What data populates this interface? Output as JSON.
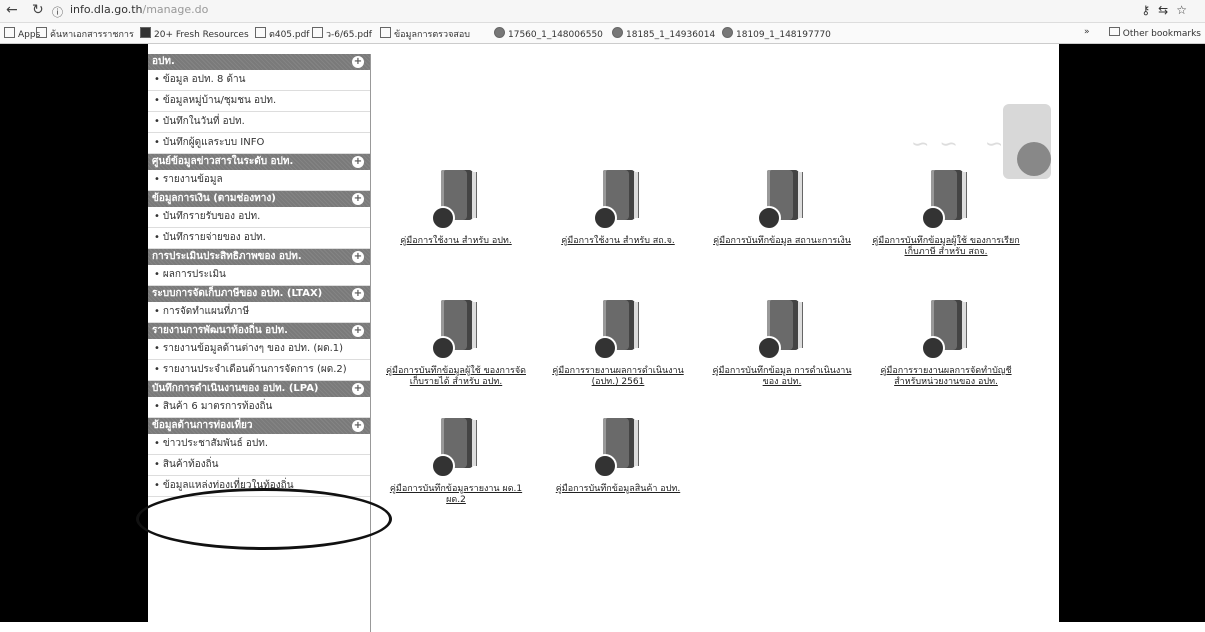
{
  "browser": {
    "url_host": "info.dla.go.th",
    "url_path": "/manage.do",
    "bookmarks": [
      "Apps",
      "ค้นหาเอกสารราชการ",
      "20+ Fresh Resources",
      "ต405.pdf",
      "ว-6/65.pdf",
      "ข้อมูลการตรวจสอบ",
      "17560_1_148006550",
      "18185_1_14936014",
      "18109_1_148197770"
    ],
    "other_bookmarks": "Other bookmarks"
  },
  "sidebar": {
    "sections": [
      {
        "title": "อปท.",
        "items": [
          "ข้อมูล อปท. 8 ด้าน",
          "ข้อมูลหมู่บ้าน/ชุมชน อปท.",
          "บันทึกในวันที่ อปท.",
          "บันทึกผู้ดูแลระบบ INFO"
        ]
      },
      {
        "title": "ศูนย์ข้อมูลข่าวสารในระดับ อปท.",
        "items": [
          "รายงานข้อมูล"
        ]
      },
      {
        "title": "ข้อมูลการเงิน (ตามช่องทาง)",
        "items": [
          "บันทึกรายรับของ อปท.",
          "บันทึกรายจ่ายของ อปท."
        ]
      },
      {
        "title": "การประเมินประสิทธิภาพของ อปท.",
        "items": [
          "ผลการประเมิน"
        ]
      },
      {
        "title": "ระบบการจัดเก็บภาษีของ อปท. (LTAX)",
        "items": [
          "การจัดทำแผนที่ภาษี"
        ]
      },
      {
        "title": "รายงานการพัฒนาท้องถิ่น อปท.",
        "items": [
          "รายงานข้อมูลด้านต่างๆ ของ อปท. (ผด.1)",
          "รายงานประจำเดือนด้านการจัดการ (ผด.2)"
        ]
      },
      {
        "title": "บันทึกการดำเนินงานของ อปท. (LPA)",
        "items": [
          "สินค้า 6 มาตรการท้องถิ่น"
        ]
      },
      {
        "title": "ข้อมูลด้านการท่องเที่ยว",
        "items": [
          "ข่าวประชาสัมพันธ์ อปท.",
          "สินค้าท้องถิ่น",
          "ข้อมูลแหล่งท่องเที่ยวในท้องถิ่น"
        ]
      }
    ]
  },
  "main": {
    "documents": [
      "คู่มือการใช้งาน สำหรับ อปท.",
      "คู่มือการใช้งาน สำหรับ สถ.จ.",
      "คู่มือการบันทึกข้อมูล สถานะการเงิน",
      "คู่มือการบันทึกข้อมูลผู้ใช้ ของการเรียกเก็บภาษี สำหรับ สถจ.",
      "คู่มือการบันทึกข้อมูลผู้ใช้ ของการจัดเก็บรายได้ สำหรับ อปท.",
      "คู่มือการรายงานผลการดำเนินงาน (อปท.) 2561",
      "คู่มือการบันทึกข้อมูล การดำเนินงานของ อปท.",
      "คู่มือการรายงานผลการจัดทำบัญชี สำหรับหน่วยงานของ อปท.",
      "คู่มือการบันทึกข้อมูลรายงาน ผด.1 ผด.2",
      "คู่มือการบันทึกข้อมูลสินค้า อปท."
    ]
  }
}
